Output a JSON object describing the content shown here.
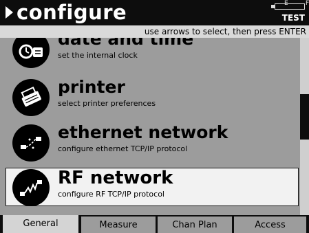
{
  "header": {
    "title": "configure",
    "battery_empty": "E",
    "battery_full": "F",
    "mode": "TEST"
  },
  "hint": "use arrows to select, then press ENTER",
  "menu": {
    "items": [
      {
        "title": "date and time",
        "desc": "set the internal clock",
        "icon": "clock-icon"
      },
      {
        "title": "printer",
        "desc": "select printer preferences",
        "icon": "printer-icon"
      },
      {
        "title": "ethernet network",
        "desc": "configure ethernet TCP/IP protocol",
        "icon": "ethernet-icon"
      },
      {
        "title": "RF network",
        "desc": "configure RF TCP/IP protocol",
        "icon": "rf-network-icon",
        "selected": true
      }
    ]
  },
  "tabs": [
    {
      "label": "General",
      "active": true
    },
    {
      "label": "Measure"
    },
    {
      "label": "Chan Plan"
    },
    {
      "label": "Access"
    }
  ]
}
